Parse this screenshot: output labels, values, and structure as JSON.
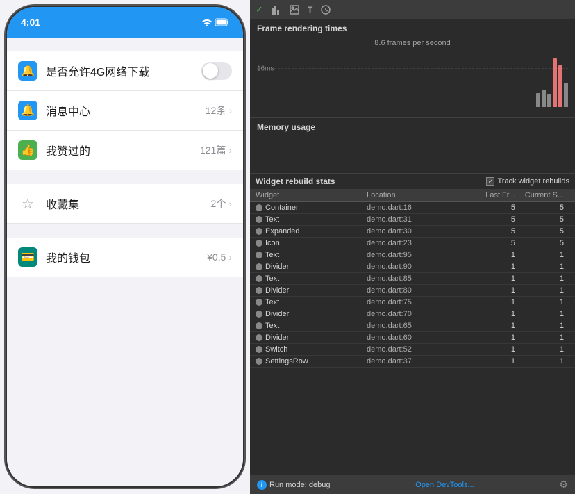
{
  "phone": {
    "status_bar": {
      "time": "4:01",
      "wifi_icon": "wifi",
      "battery_icon": "battery"
    },
    "menu_items": [
      {
        "id": "allow-4g",
        "icon": "🔔",
        "icon_color": "blue",
        "label": "是否允许4G网络下载",
        "type": "toggle",
        "value": "off"
      },
      {
        "id": "message-center",
        "icon": "🔔",
        "icon_color": "blue",
        "label": "消息中心",
        "type": "count",
        "value": "12条"
      },
      {
        "id": "liked",
        "icon": "👍",
        "icon_color": "green",
        "label": "我赞过的",
        "type": "count",
        "value": "121篇"
      },
      {
        "id": "favorites",
        "icon": "☆",
        "icon_color": "gray",
        "label": "收藏集",
        "type": "count",
        "value": "2个"
      },
      {
        "id": "wallet",
        "icon": "💳",
        "icon_color": "teal",
        "label": "我的钱包",
        "type": "count",
        "value": "¥0.5"
      }
    ]
  },
  "debug_panel": {
    "toolbar": {
      "icons": [
        "chart-bar",
        "image",
        "text-format",
        "clock"
      ]
    },
    "frame_rendering": {
      "title": "Frame rendering times",
      "fps": "8.6 frames per second",
      "line_label": "16ms",
      "bars": [
        {
          "height": 20,
          "type": "gray"
        },
        {
          "height": 30,
          "type": "gray"
        },
        {
          "height": 25,
          "type": "gray"
        },
        {
          "height": 90,
          "type": "red"
        },
        {
          "height": 75,
          "type": "red"
        },
        {
          "height": 45,
          "type": "gray"
        }
      ]
    },
    "memory_usage": {
      "title": "Memory usage"
    },
    "widget_rebuild": {
      "title": "Widget rebuild stats",
      "track_label": "Track widget rebuilds",
      "columns": [
        "Widget",
        "Location",
        "Last Fr...",
        "Current S..."
      ],
      "rows": [
        {
          "widget": "Container",
          "location": "demo.dart:16",
          "last": "5",
          "current": "5"
        },
        {
          "widget": "Text",
          "location": "demo.dart:31",
          "last": "5",
          "current": "5"
        },
        {
          "widget": "Expanded",
          "location": "demo.dart:30",
          "last": "5",
          "current": "5"
        },
        {
          "widget": "Icon",
          "location": "demo.dart:23",
          "last": "5",
          "current": "5"
        },
        {
          "widget": "Text",
          "location": "demo.dart:95",
          "last": "1",
          "current": "1"
        },
        {
          "widget": "Divider",
          "location": "demo.dart:90",
          "last": "1",
          "current": "1"
        },
        {
          "widget": "Text",
          "location": "demo.dart:85",
          "last": "1",
          "current": "1"
        },
        {
          "widget": "Divider",
          "location": "demo.dart:80",
          "last": "1",
          "current": "1"
        },
        {
          "widget": "Text",
          "location": "demo.dart:75",
          "last": "1",
          "current": "1"
        },
        {
          "widget": "Divider",
          "location": "demo.dart:70",
          "last": "1",
          "current": "1"
        },
        {
          "widget": "Text",
          "location": "demo.dart:65",
          "last": "1",
          "current": "1"
        },
        {
          "widget": "Divider",
          "location": "demo.dart:60",
          "last": "1",
          "current": "1"
        },
        {
          "widget": "Switch",
          "location": "demo.dart:52",
          "last": "1",
          "current": "1"
        },
        {
          "widget": "SettingsRow",
          "location": "demo.dart:37",
          "last": "1",
          "current": "1"
        }
      ]
    },
    "bottom_bar": {
      "run_mode": "Run mode: debug",
      "open_devtools": "Open DevTools..."
    }
  }
}
